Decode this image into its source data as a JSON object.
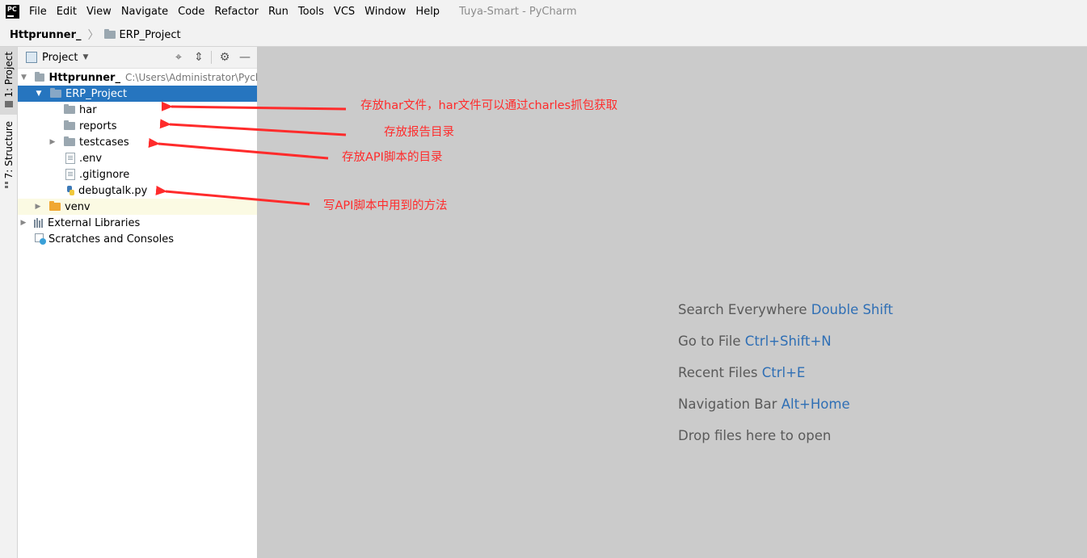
{
  "menubar": {
    "logo_text": "PC",
    "items": [
      "File",
      "Edit",
      "View",
      "Navigate",
      "Code",
      "Refactor",
      "Run",
      "Tools",
      "VCS",
      "Window",
      "Help"
    ],
    "window_title": "Tuya-Smart - PyCharm"
  },
  "breadcrumb": {
    "root": "Httprunner_",
    "child": "ERP_Project"
  },
  "tool_strip": {
    "project_tab": "1: Project",
    "structure_tab": "7: Structure"
  },
  "project_panel": {
    "title": "Project",
    "tree": {
      "root_name": "Httprunner_",
      "root_path": "C:\\Users\\Administrator\\Pychar",
      "items": [
        {
          "label": "ERP_Project",
          "icon": "folder-icon"
        },
        {
          "label": "har",
          "icon": "folder-icon"
        },
        {
          "label": "reports",
          "icon": "folder-icon"
        },
        {
          "label": "testcases",
          "icon": "folder-icon"
        },
        {
          "label": ".env",
          "icon": "text-file-icon"
        },
        {
          "label": ".gitignore",
          "icon": "ignore-file-icon"
        },
        {
          "label": "debugtalk.py",
          "icon": "python-file-icon"
        },
        {
          "label": "venv",
          "icon": "excluded-folder-icon"
        },
        {
          "label": "External Libraries",
          "icon": "library-icon"
        },
        {
          "label": "Scratches and Consoles",
          "icon": "scratch-icon"
        }
      ]
    }
  },
  "editor": {
    "hints": [
      {
        "text": "Search Everywhere",
        "shortcut": "Double Shift"
      },
      {
        "text": "Go to File",
        "shortcut": "Ctrl+Shift+N"
      },
      {
        "text": "Recent Files",
        "shortcut": "Ctrl+E"
      },
      {
        "text": "Navigation Bar",
        "shortcut": "Alt+Home"
      },
      {
        "text": "Drop files here to open",
        "shortcut": ""
      }
    ]
  },
  "annotations": [
    {
      "text": "存放har文件，har文件可以通过charles抓包获取",
      "color": "#ff2b2b"
    },
    {
      "text": "存放报告目录",
      "color": "#ff2b2b"
    },
    {
      "text": "存放API脚本的目录",
      "color": "#ff2b2b"
    },
    {
      "text": "写API脚本中用到的方法",
      "color": "#ff2b2b"
    }
  ],
  "colors": {
    "selection": "#2675bf",
    "editor_bg": "#cbcbcb",
    "shortcut": "#2f6fb5",
    "annotation": "#ff2b2b"
  }
}
